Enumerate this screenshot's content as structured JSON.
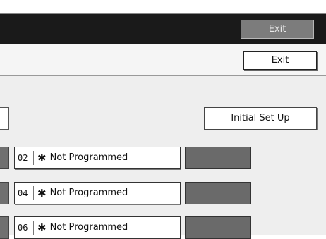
{
  "title_bar": {
    "exit_label": "Exit"
  },
  "header": {
    "exit_label": "Exit"
  },
  "actions": {
    "initial_setup_label": "Initial Set Up"
  },
  "programs": [
    {
      "number": "02",
      "marker": "✱",
      "label": "Not Programmed"
    },
    {
      "number": "04",
      "marker": "✱",
      "label": "Not Programmed"
    },
    {
      "number": "06",
      "marker": "✱",
      "label": "Not Programmed"
    }
  ]
}
